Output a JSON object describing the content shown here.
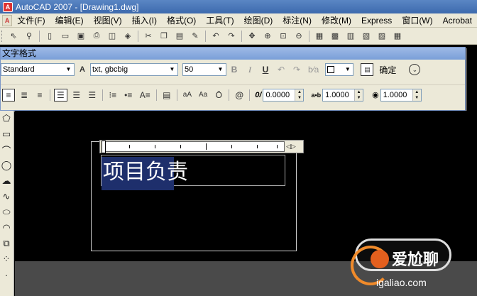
{
  "window": {
    "title": "AutoCAD 2007 - [Drawing1.dwg]",
    "app_icon": "A"
  },
  "menubar": {
    "items": [
      "文件(F)",
      "编辑(E)",
      "视图(V)",
      "插入(I)",
      "格式(O)",
      "工具(T)",
      "绘图(D)",
      "标注(N)",
      "修改(M)",
      "Express",
      "窗口(W)",
      "Acrobat"
    ]
  },
  "std_toolbar": {
    "icons": [
      "qnew-icon",
      "open-icon",
      "save-icon",
      "plot-icon",
      "preview-icon",
      "publish-icon",
      "cut-icon",
      "copy-icon",
      "paste-icon",
      "matchprop-icon",
      "undo-icon",
      "redo-icon",
      "pan-icon",
      "zoom-realtime-icon",
      "zoom-window-icon",
      "zoom-previous-icon",
      "properties-icon",
      "designcenter-icon",
      "toolpalette-icon",
      "sheetset-icon",
      "markup-icon",
      "calculator-icon"
    ]
  },
  "text_format": {
    "title": "文字格式",
    "style": "Standard",
    "font": "txt, gbcbig",
    "font_icon": "A",
    "height": "50",
    "bold": "B",
    "italic": "I",
    "underline": "U",
    "ok_label": "确定",
    "oblique_value": "0.0000",
    "tracking_value": "1.0000",
    "width_value": "1.0000",
    "oblique_label": "0/",
    "tracking_label": "a•b",
    "at_symbol": "@"
  },
  "editor": {
    "selected_text": "项目负责"
  },
  "watermark": {
    "text": "爱尬聊",
    "url": "igaliao.com"
  },
  "colors": {
    "selection": "#1e2f6c",
    "canvas": "#000000",
    "toolbar_bg": "#ece9d8",
    "titlebar": "#3d6aad"
  }
}
